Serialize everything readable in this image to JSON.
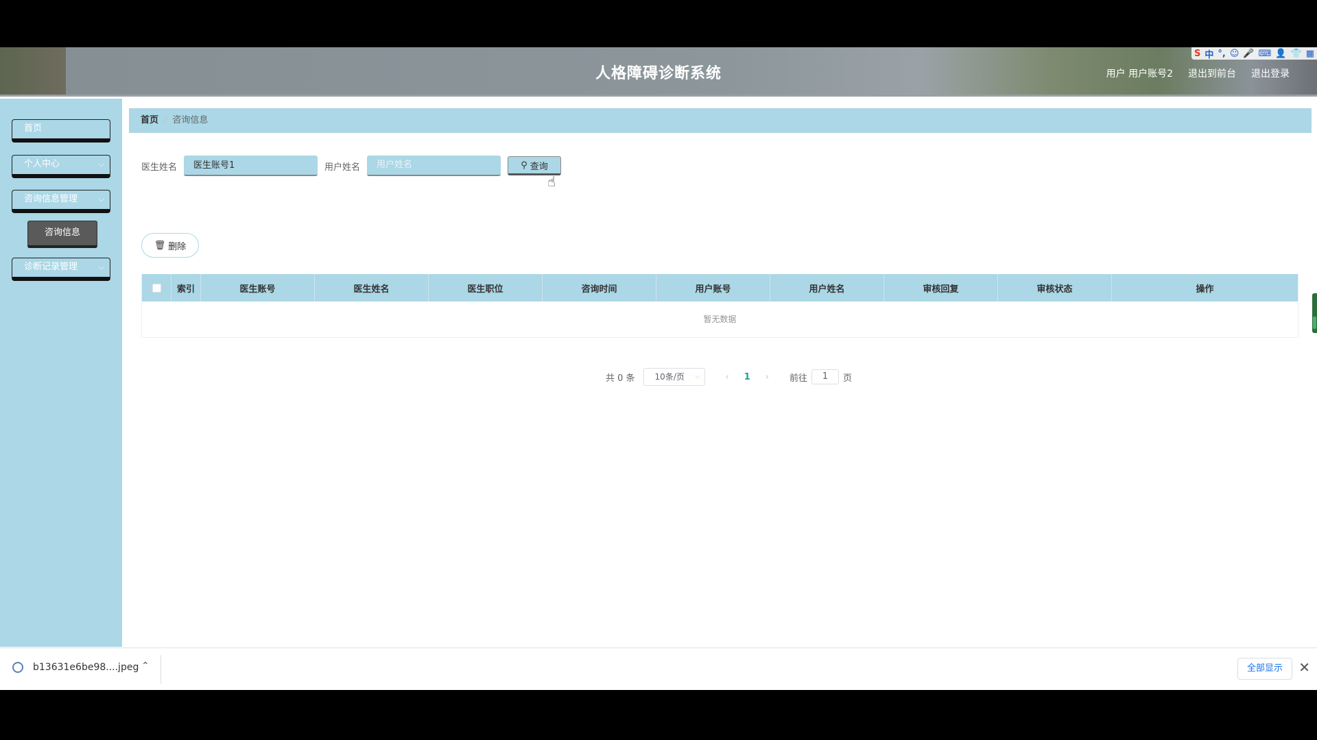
{
  "header": {
    "title": "人格障碍诊断系统",
    "user_label": "用户 用户账号2",
    "back_to_front": "退出到前台",
    "logout": "退出登录",
    "ime_icons": [
      "S",
      "中",
      "°,",
      "☺",
      "🎤",
      "⌨",
      "👤",
      "👕",
      "▦"
    ]
  },
  "sidebar": {
    "items": [
      {
        "label": "首页"
      },
      {
        "label": "个人中心"
      },
      {
        "label": "咨询信息管理"
      },
      {
        "label": "诊断记录管理"
      }
    ],
    "sub_item": "咨询信息"
  },
  "breadcrumb": {
    "home": "首页",
    "separator": "/",
    "current": "咨询信息"
  },
  "search": {
    "doctor_name_label": "医生姓名",
    "doctor_name_value": "医生账号1",
    "user_name_label": "用户姓名",
    "user_name_placeholder": "用户姓名",
    "button_label": "查询"
  },
  "actions": {
    "delete_label": "删除"
  },
  "table": {
    "headers": [
      "索引",
      "医生账号",
      "医生姓名",
      "医生职位",
      "咨询时间",
      "用户账号",
      "用户姓名",
      "审核回复",
      "审核状态",
      "操作"
    ],
    "empty_text": "暂无数据"
  },
  "pagination": {
    "total_text": "共 0 条",
    "page_size": "10条/页",
    "current_page": "1",
    "goto_label": "前往",
    "goto_value": "1",
    "page_suffix": "页"
  },
  "download_bar": {
    "filename": "b13631e6be98....jpeg",
    "show_all": "全部显示"
  },
  "colors": {
    "accent": "#abd7e6",
    "page_active": "#19a58c"
  }
}
